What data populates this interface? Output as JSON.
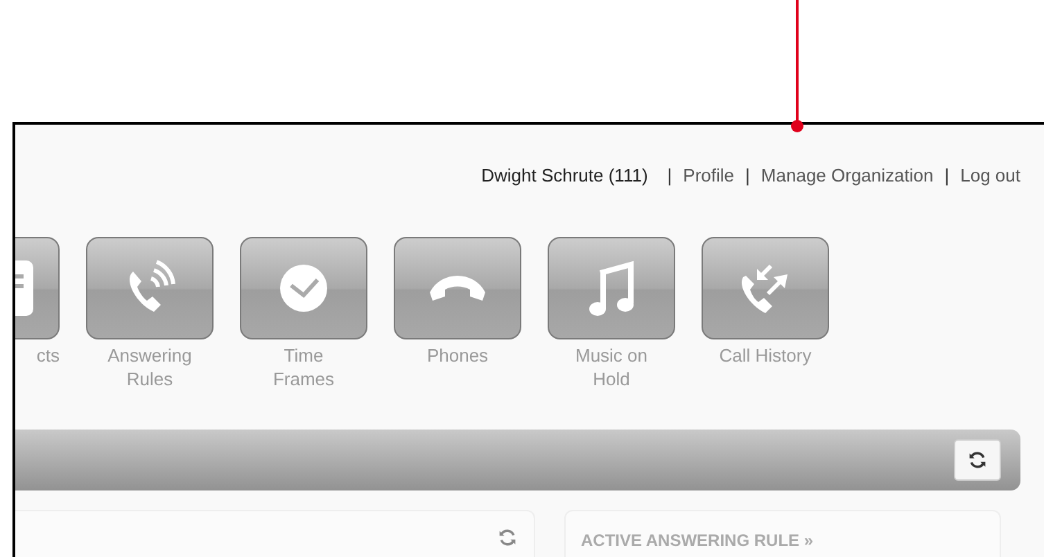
{
  "user_nav": [
    {
      "kind": "user",
      "text": "Dwight Schrute (111)"
    },
    {
      "kind": "separator",
      "text": "|"
    },
    {
      "kind": "link",
      "text": "Profile"
    },
    {
      "kind": "separator",
      "text": "|"
    },
    {
      "kind": "link",
      "text": "Manage Organization"
    },
    {
      "kind": "separator",
      "text": "|"
    },
    {
      "kind": "link",
      "text": "Log out"
    }
  ],
  "tiles": [
    {
      "kind": "contacts",
      "label": "cts"
    },
    {
      "kind": "answering",
      "label": "Answering Rules"
    },
    {
      "kind": "time",
      "label": "Time Frames"
    },
    {
      "kind": "phones",
      "label": "Phones"
    },
    {
      "kind": "music",
      "label": "Music on Hold"
    },
    {
      "kind": "history",
      "label": "Call History"
    }
  ],
  "panels": [
    {
      "kind": "plain"
    },
    {
      "kind": "titled",
      "title": "ACTIVE ANSWERING RULE »"
    }
  ]
}
